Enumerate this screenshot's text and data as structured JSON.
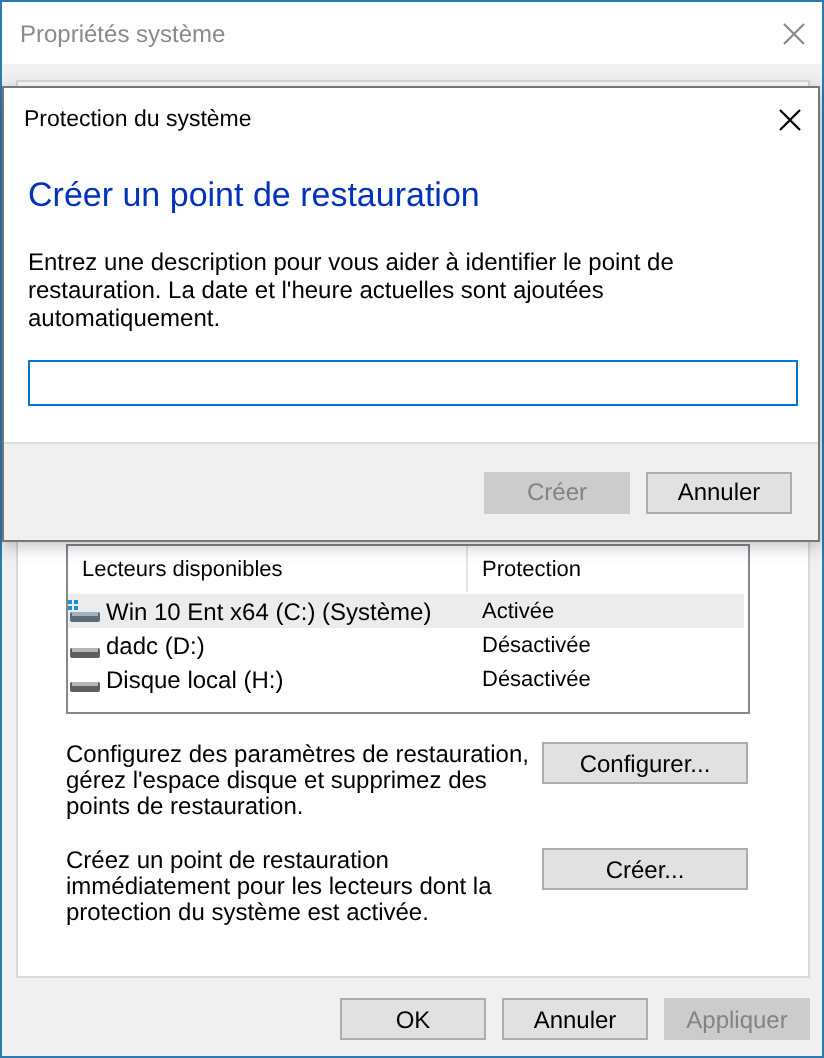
{
  "window": {
    "title": "Propriétés système"
  },
  "drives": {
    "columns": [
      "Lecteurs disponibles",
      "Protection"
    ],
    "rows": [
      {
        "name": "Win 10 Ent x64 (C:) (Système)",
        "protection": "Activée",
        "kind": "system",
        "selected": true
      },
      {
        "name": "dadc (D:)",
        "protection": "Désactivée",
        "kind": "disk",
        "selected": false
      },
      {
        "name": "Disque local (H:)",
        "protection": "Désactivée",
        "kind": "disk",
        "selected": false
      }
    ]
  },
  "actions": [
    {
      "text": "Configurez des paramètres de restauration, gérez l'espace disque et supprimez des points de restauration.",
      "button": "Configurer..."
    },
    {
      "text": "Créez un point de restauration immédiatement pour les lecteurs dont la protection du système est activée.",
      "button": "Créer..."
    }
  ],
  "buttons": [
    {
      "label": "OK",
      "disabled": false
    },
    {
      "label": "Annuler",
      "disabled": false
    },
    {
      "label": "Appliquer",
      "disabled": true
    }
  ],
  "dialog": {
    "title": "Protection du système",
    "heading": "Créer un point de restauration",
    "description": "Entrez une description pour vous aider à identifier le point de restauration. La date et l'heure actuelles sont ajoutées automatiquement.",
    "buttons": [
      {
        "label": "Créer",
        "disabled": true
      },
      {
        "label": "Annuler",
        "disabled": false
      }
    ]
  }
}
